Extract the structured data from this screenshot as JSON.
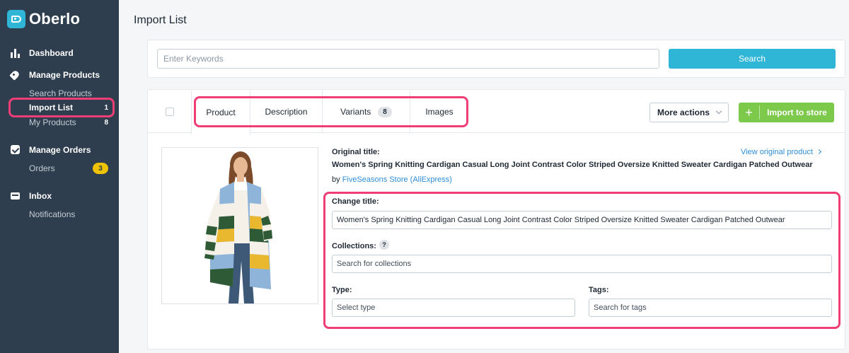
{
  "app": {
    "logo_text": "Oberlo"
  },
  "sidebar": {
    "dashboard": "Dashboard",
    "manage_products": "Manage Products",
    "search_products": "Search Products",
    "import_list": "Import List",
    "import_list_count": "1",
    "my_products": "My Products",
    "my_products_count": "8",
    "manage_orders": "Manage Orders",
    "orders": "Orders",
    "orders_count": "3",
    "inbox": "Inbox",
    "notifications": "Notifications"
  },
  "page": {
    "title": "Import List"
  },
  "search": {
    "placeholder": "Enter Keywords",
    "button": "Search"
  },
  "tabs": {
    "product": "Product",
    "description": "Description",
    "variants": "Variants",
    "variants_count": "8",
    "images": "Images"
  },
  "actions": {
    "more": "More actions",
    "import": "Import to store",
    "plus": "+"
  },
  "product": {
    "original_title_label": "Original title:",
    "original_title": "Women's Spring Knitting Cardigan Casual Long Joint Contrast Color Striped Oversize Knitted Sweater Cardigan Patched Outwear",
    "by": "by",
    "store": "FiveSeasons Store (AliExpress)",
    "view_original": "View original product",
    "change_title_label": "Change title:",
    "change_title_value": "Women's Spring Knitting Cardigan Casual Long Joint Contrast Color Striped Oversize Knitted Sweater Cardigan Patched Outwear",
    "collections_label": "Collections:",
    "collections_help": "?",
    "collections_placeholder": "Search for collections",
    "type_label": "Type:",
    "type_placeholder": "Select type",
    "tags_label": "Tags:",
    "tags_placeholder": "Search for tags"
  },
  "colors": {
    "accent": "#2fb5d6",
    "import_green": "#7cc94b",
    "highlight": "#ef3e76",
    "sidebar_bg": "#2f3e4e"
  }
}
